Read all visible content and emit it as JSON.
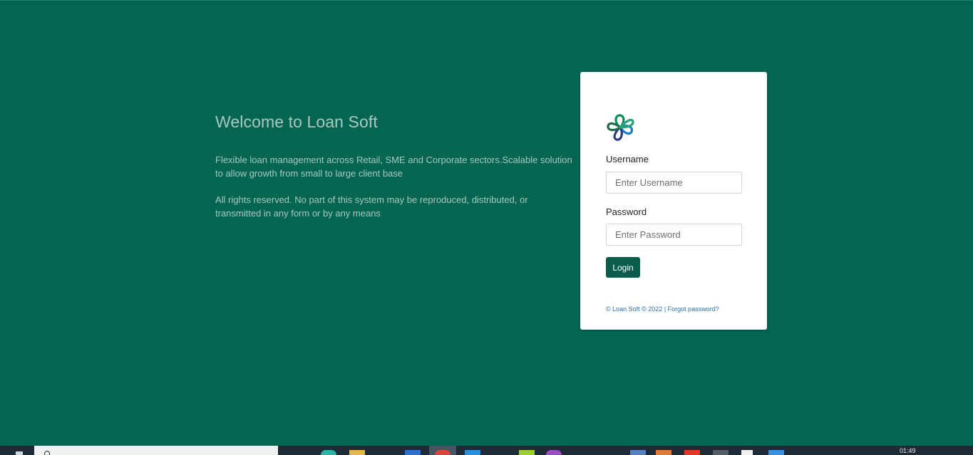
{
  "welcome": {
    "title": "Welcome to Loan Soft",
    "description": "Flexible loan management across Retail, SME and Corporate sectors.Scalable solution to allow growth from small to large client base",
    "rights": "All rights reserved. No part of this system may be reproduced, distributed, or transmitted in any form or by any means"
  },
  "login": {
    "username_label": "Username",
    "username_placeholder": "Enter Username",
    "username_value": "",
    "password_label": "Password",
    "password_placeholder": "Enter Password",
    "password_value": "",
    "submit_label": "Login",
    "footer_copyright": "© Loan Soft © 2022",
    "footer_separator": " | ",
    "forgot_password": "Forgot password?"
  },
  "taskbar": {
    "clock": "01:49"
  },
  "colors": {
    "background": "#046650",
    "button": "#0a5d4a",
    "welcome_text": "#a9c7bf",
    "link": "#2e6fa3"
  },
  "icons": {
    "logo": "flower-logo-icon",
    "search": "search-icon"
  }
}
